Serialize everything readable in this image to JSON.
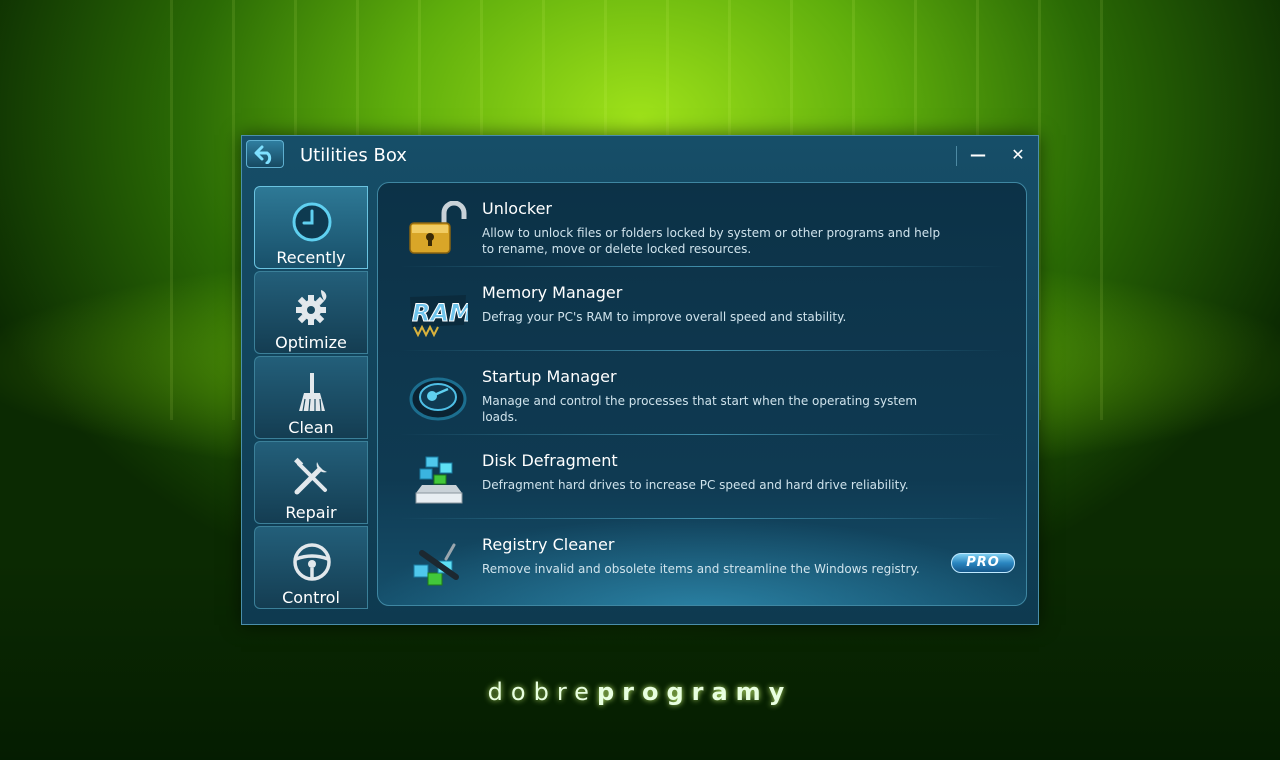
{
  "window": {
    "title": "Utilities Box"
  },
  "titlebar": {
    "back_icon": "back-arrow-icon",
    "minimize_label": "—",
    "close_label": "✕"
  },
  "sidebar": {
    "items": [
      {
        "label": "Recently",
        "icon": "clock-icon",
        "active": true
      },
      {
        "label": "Optimize",
        "icon": "gear-icon",
        "active": false
      },
      {
        "label": "Clean",
        "icon": "broom-icon",
        "active": false
      },
      {
        "label": "Repair",
        "icon": "wrench-screwdriver-icon",
        "active": false
      },
      {
        "label": "Control",
        "icon": "steering-wheel-icon",
        "active": false
      }
    ]
  },
  "tools": [
    {
      "title": "Unlocker",
      "description": "Allow to unlock files or folders locked by system or other programs and help to rename, move or delete locked resources.",
      "icon": "padlock-icon"
    },
    {
      "title": "Memory Manager",
      "description": "Defrag your PC's RAM to improve overall speed and stability.",
      "icon": "ram-icon"
    },
    {
      "title": "Startup Manager",
      "description": "Manage and control the processes that start when the operating system loads.",
      "icon": "startup-gauge-icon"
    },
    {
      "title": "Disk Defragment",
      "description": "Defragment hard drives to increase PC speed and hard drive reliability.",
      "icon": "disk-defrag-icon"
    },
    {
      "title": "Registry Cleaner",
      "description": "Remove invalid and obsolete items and streamline the Windows registry.",
      "icon": "registry-cleaner-icon",
      "badge": "PRO"
    }
  ],
  "watermark": {
    "part1": "dobre",
    "part2": "programy"
  },
  "colors": {
    "accent": "#2f7ea0",
    "clock_cyan": "#5fd0f0",
    "padlock_gold": "#d9a628"
  }
}
